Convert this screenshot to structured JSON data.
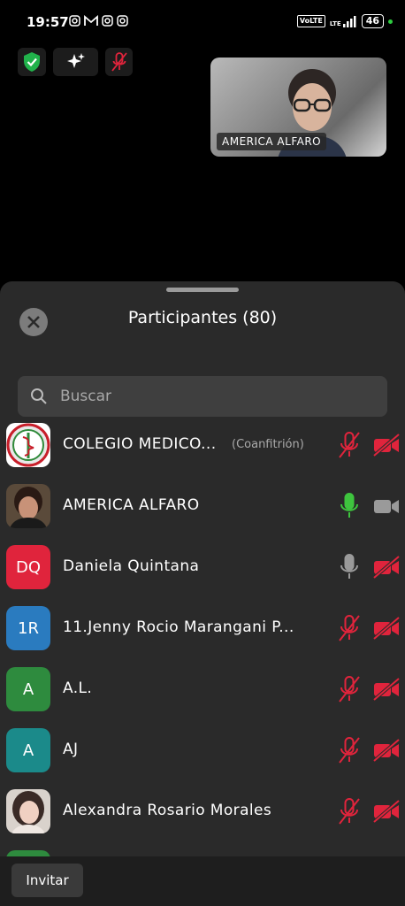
{
  "status_bar": {
    "time": "19:57",
    "volte": "VoLTE",
    "lte": "LTE",
    "battery": "46",
    "notif_icons": [
      "instagram-icon",
      "instagram-icon",
      "gmail-icon",
      "instagram-icon",
      "instagram-icon"
    ]
  },
  "top_tools": [
    "shield-icon",
    "sparkle-icon",
    "mic-off-icon"
  ],
  "video": {
    "name": "AMERICA ALFARO"
  },
  "panel": {
    "title": "Participantes (80)",
    "search_placeholder": "Buscar"
  },
  "participants": [
    {
      "name": "COLEGIO MEDICO...",
      "role": "(Coanfitrión)",
      "avatar_type": "logo",
      "mic": "off",
      "cam": "off"
    },
    {
      "name": "AMERICA ALFARO",
      "role": "",
      "avatar_type": "photo",
      "mic": "on",
      "cam": "on"
    },
    {
      "name": "Daniela Quintana",
      "role": "",
      "initials": "DQ",
      "avatar_color": "#e0243c",
      "mic": "idle",
      "cam": "off"
    },
    {
      "name": "11.Jenny Rocio Marangani P...",
      "role": "",
      "initials": "1R",
      "avatar_color": "#2a7bbf",
      "mic": "off",
      "cam": "off"
    },
    {
      "name": "A.L.",
      "role": "",
      "initials": "A",
      "avatar_color": "#2e8b3e",
      "mic": "off",
      "cam": "off"
    },
    {
      "name": "AJ",
      "role": "",
      "initials": "A",
      "avatar_color": "#1b8a8a",
      "mic": "off",
      "cam": "off"
    },
    {
      "name": "Alexandra Rosario Morales",
      "role": "",
      "avatar_type": "photo2",
      "mic": "off",
      "cam": "off"
    }
  ],
  "bottom": {
    "invite_label": "Invitar"
  },
  "colors": {
    "muted_red": "#e0243c",
    "mic_green": "#3ec43e",
    "sheet_bg": "#2a2a2a"
  }
}
